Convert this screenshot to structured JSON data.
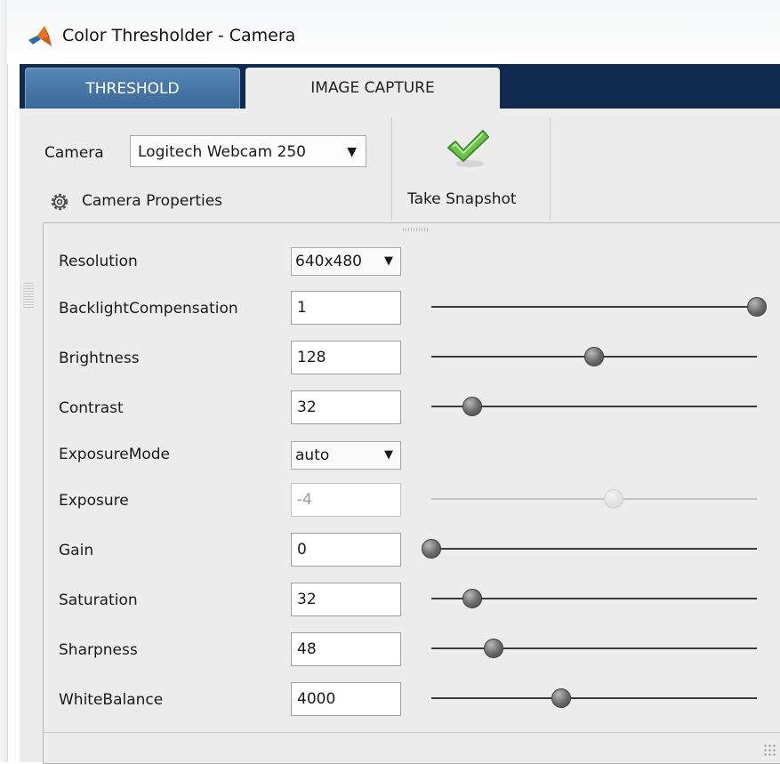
{
  "window": {
    "title": "Color Thresholder - Camera"
  },
  "tabs": [
    {
      "label": "THRESHOLD",
      "active": false
    },
    {
      "label": "IMAGE CAPTURE",
      "active": true
    }
  ],
  "toolstrip": {
    "camera_label": "Camera",
    "camera_selected": "Logitech Webcam 250",
    "camera_properties_label": "Camera Properties",
    "snapshot_label": "Take Snapshot"
  },
  "properties": [
    {
      "name": "Resolution",
      "control": "dropdown",
      "value": "640x480"
    },
    {
      "name": "BacklightCompensation",
      "control": "slider",
      "value": "1",
      "level": 1.0
    },
    {
      "name": "Brightness",
      "control": "slider",
      "value": "128",
      "level": 0.5
    },
    {
      "name": "Contrast",
      "control": "slider",
      "value": "32",
      "level": 0.125
    },
    {
      "name": "ExposureMode",
      "control": "dropdown",
      "value": "auto"
    },
    {
      "name": "Exposure",
      "control": "slider",
      "value": "-4",
      "level": 0.56,
      "disabled": true
    },
    {
      "name": "Gain",
      "control": "slider",
      "value": "0",
      "level": 0.0
    },
    {
      "name": "Saturation",
      "control": "slider",
      "value": "32",
      "level": 0.125
    },
    {
      "name": "Sharpness",
      "control": "slider",
      "value": "48",
      "level": 0.19
    },
    {
      "name": "WhiteBalance",
      "control": "slider",
      "value": "4000",
      "level": 0.4
    }
  ],
  "icons": {
    "app": "matlab-logo-icon",
    "camera_properties": "gear-icon",
    "snapshot": "checkmark-icon",
    "dropdown": "caret-down-icon"
  },
  "colors": {
    "tabstrip_bg": "#0f2a4c",
    "inactive_tab": "#3a6897",
    "toolstrip_bg": "#ececec",
    "check_green": "#6cc24a"
  }
}
